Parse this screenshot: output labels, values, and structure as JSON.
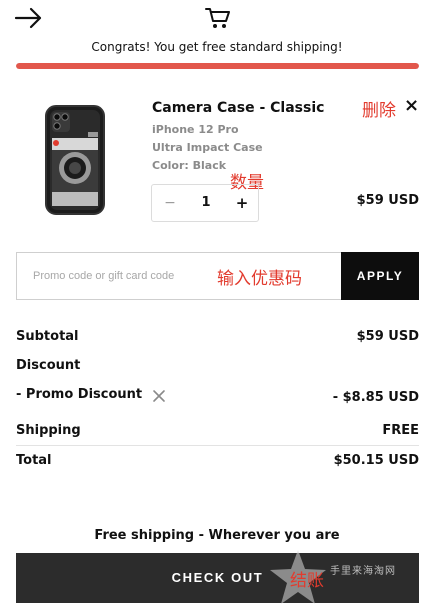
{
  "header": {
    "back_icon": "arrow-right-icon",
    "cart_icon": "cart-icon",
    "congrats_text": "Congrats! You get free standard shipping!",
    "shipping_progress": 1.0,
    "progress_color": "#e2574c"
  },
  "product": {
    "title": "Camera Case - Classic",
    "model": "iPhone 12 Pro",
    "case_type": "Ultra Impact Case",
    "color": "Color: Black",
    "quantity": "1",
    "minus_label": "−",
    "plus_label": "+",
    "price": "$59 USD",
    "remove_label": "×",
    "delete_annotation": "删除",
    "quantity_annotation": "数量"
  },
  "promo": {
    "placeholder": "Promo code or gift card code",
    "annotation": "输入优惠码",
    "apply_label": "APPLY"
  },
  "summary": {
    "subtotal_label": "Subtotal",
    "subtotal_value": "$59 USD",
    "discount_label": "Discount",
    "promo_discount_label": "- Promo Discount",
    "promo_discount_value": "- $8.85 USD",
    "shipping_label": "Shipping",
    "shipping_value": "FREE",
    "total_label": "Total",
    "total_value": "$50.15 USD"
  },
  "footer": {
    "free_shipping_text": "Free shipping - Wherever you are",
    "checkout_label": "CHECK OUT",
    "checkout_annotation": "结账",
    "watermark_text": "手里来海淘网"
  },
  "colors": {
    "accent_red": "#e23b2e",
    "checkout_bg": "#2c2c2c",
    "apply_bg": "#0d0d0d"
  }
}
